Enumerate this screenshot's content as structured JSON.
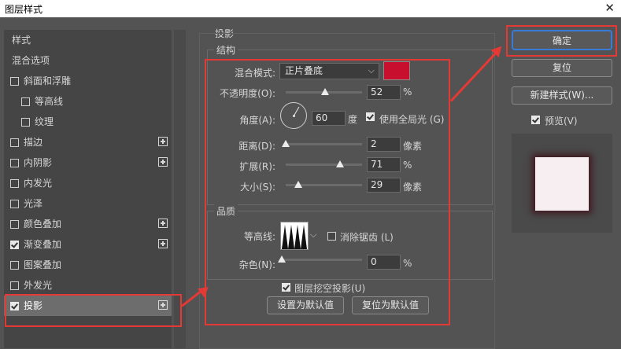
{
  "window": {
    "title": "图层样式",
    "close_glyph": "✕"
  },
  "left_panel": {
    "items": [
      {
        "label": "样式",
        "checkbox": false,
        "checked": false,
        "plus": false,
        "indent": 0
      },
      {
        "label": "混合选项",
        "checkbox": false,
        "checked": false,
        "plus": false,
        "indent": 0
      },
      {
        "label": "斜面和浮雕",
        "checkbox": true,
        "checked": false,
        "plus": false,
        "indent": 0
      },
      {
        "label": "等高线",
        "checkbox": true,
        "checked": false,
        "plus": false,
        "indent": 1
      },
      {
        "label": "纹理",
        "checkbox": true,
        "checked": false,
        "plus": false,
        "indent": 1
      },
      {
        "label": "描边",
        "checkbox": true,
        "checked": false,
        "plus": true,
        "indent": 0
      },
      {
        "label": "内阴影",
        "checkbox": true,
        "checked": false,
        "plus": true,
        "indent": 0
      },
      {
        "label": "内发光",
        "checkbox": true,
        "checked": false,
        "plus": false,
        "indent": 0
      },
      {
        "label": "光泽",
        "checkbox": true,
        "checked": false,
        "plus": false,
        "indent": 0
      },
      {
        "label": "颜色叠加",
        "checkbox": true,
        "checked": false,
        "plus": true,
        "indent": 0
      },
      {
        "label": "渐变叠加",
        "checkbox": true,
        "checked": true,
        "plus": true,
        "indent": 0
      },
      {
        "label": "图案叠加",
        "checkbox": true,
        "checked": false,
        "plus": false,
        "indent": 0
      },
      {
        "label": "外发光",
        "checkbox": true,
        "checked": false,
        "plus": false,
        "indent": 0
      },
      {
        "label": "投影",
        "checkbox": true,
        "checked": true,
        "plus": true,
        "indent": 0,
        "selected": true
      }
    ]
  },
  "drop_shadow": {
    "section_title": "投影",
    "structure": {
      "title": "结构",
      "blend_mode_label": "混合模式:",
      "blend_mode_value": "正片叠底",
      "shadow_color": "#c8102e",
      "opacity_label": "不透明度(O):",
      "opacity_value": "52",
      "opacity_fraction": 0.52,
      "opacity_unit": "%",
      "angle_label": "角度(A):",
      "angle_value": "60",
      "angle_unit": "度",
      "global_light_label": "使用全局光 (G)",
      "global_light_checked": true,
      "distance_label": "距离(D):",
      "distance_value": "2",
      "distance_fraction": 0.0,
      "distance_unit": "像素",
      "spread_label": "扩展(R):",
      "spread_value": "71",
      "spread_fraction": 0.71,
      "spread_unit": "%",
      "size_label": "大小(S):",
      "size_value": "29",
      "size_fraction": 0.16,
      "size_unit": "像素"
    },
    "quality": {
      "title": "品质",
      "contour_label": "等高线:",
      "anti_alias_label": "消除锯齿 (L)",
      "anti_alias_checked": false,
      "noise_label": "杂色(N):",
      "noise_value": "0",
      "noise_fraction": 0.0,
      "noise_unit": "%"
    },
    "knockout_label": "图层挖空投影(U)",
    "knockout_checked": true,
    "set_default_label": "设置为默认值",
    "reset_default_label": "复位为默认值"
  },
  "right_panel": {
    "ok_label": "确定",
    "reset_label": "复位",
    "new_style_label": "新建样式(W)...",
    "preview_label": "预览(V)",
    "preview_checked": true
  },
  "colors": {
    "highlight_red": "#e53935",
    "ok_border": "#3b7bd8"
  }
}
